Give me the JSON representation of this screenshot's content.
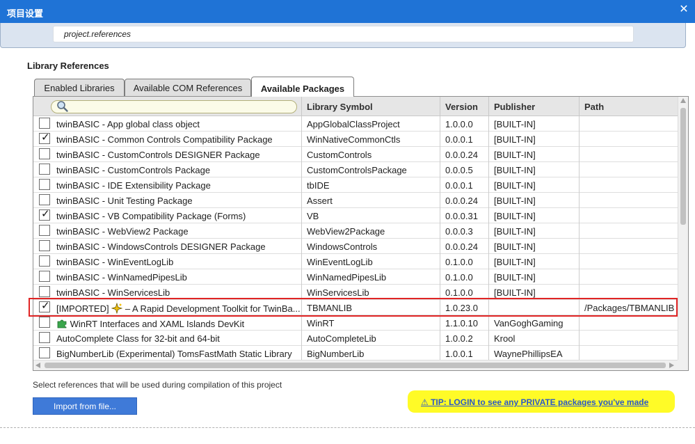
{
  "window": {
    "title": "项目设置",
    "close_glyph": "✕"
  },
  "search": {
    "value": "project.references"
  },
  "section": {
    "title": "Library References"
  },
  "tabs": [
    {
      "label": "Enabled Libraries",
      "active": false
    },
    {
      "label": "Available COM References",
      "active": false
    },
    {
      "label": "Available Packages",
      "active": true
    }
  ],
  "table": {
    "filter_icon": "magnifier-icon",
    "columns": [
      "",
      "Library Symbol",
      "Version",
      "Publisher",
      "Path"
    ],
    "rows": [
      {
        "checked": false,
        "name": "twinBASIC - App global class object",
        "symbol": "AppGlobalClassProject",
        "version": "1.0.0.0",
        "publisher": "[BUILT-IN]",
        "path": ""
      },
      {
        "checked": true,
        "name": "twinBASIC - Common Controls Compatibility Package",
        "symbol": "WinNativeCommonCtls",
        "version": "0.0.0.1",
        "publisher": "[BUILT-IN]",
        "path": ""
      },
      {
        "checked": false,
        "name": "twinBASIC - CustomControls DESIGNER Package",
        "symbol": "CustomControls",
        "version": "0.0.0.24",
        "publisher": "[BUILT-IN]",
        "path": ""
      },
      {
        "checked": false,
        "name": "twinBASIC - CustomControls Package",
        "symbol": "CustomControlsPackage",
        "version": "0.0.0.5",
        "publisher": "[BUILT-IN]",
        "path": ""
      },
      {
        "checked": false,
        "name": "twinBASIC - IDE Extensibility Package",
        "symbol": "tbIDE",
        "version": "0.0.0.1",
        "publisher": "[BUILT-IN]",
        "path": ""
      },
      {
        "checked": false,
        "name": "twinBASIC - Unit Testing Package",
        "symbol": "Assert",
        "version": "0.0.0.24",
        "publisher": "[BUILT-IN]",
        "path": ""
      },
      {
        "checked": true,
        "name": "twinBASIC - VB Compatibility Package (Forms)",
        "symbol": "VB",
        "version": "0.0.0.31",
        "publisher": "[BUILT-IN]",
        "path": ""
      },
      {
        "checked": false,
        "name": "twinBASIC - WebView2 Package",
        "symbol": "WebView2Package",
        "version": "0.0.0.3",
        "publisher": "[BUILT-IN]",
        "path": ""
      },
      {
        "checked": false,
        "name": "twinBASIC - WindowsControls DESIGNER Package",
        "symbol": "WindowsControls",
        "version": "0.0.0.24",
        "publisher": "[BUILT-IN]",
        "path": ""
      },
      {
        "checked": false,
        "name": "twinBASIC - WinEventLogLib",
        "symbol": "WinEventLogLib",
        "version": "0.1.0.0",
        "publisher": "[BUILT-IN]",
        "path": ""
      },
      {
        "checked": false,
        "name": "twinBASIC - WinNamedPipesLib",
        "symbol": "WinNamedPipesLib",
        "version": "0.1.0.0",
        "publisher": "[BUILT-IN]",
        "path": ""
      },
      {
        "checked": false,
        "name": "twinBASIC - WinServicesLib",
        "symbol": "WinServicesLib",
        "version": "0.1.0.0",
        "publisher": "[BUILT-IN]",
        "path": ""
      },
      {
        "checked": true,
        "name_prefix": "[IMPORTED]",
        "name_icon": "sparkle-icon",
        "name": "– A Rapid Development Toolkit for TwinBa...",
        "symbol": "TBMANLIB",
        "version": "1.0.23.0",
        "publisher": "",
        "path": "/Packages/TBMANLIB",
        "highlighted": true
      },
      {
        "checked": false,
        "name_icon": "puzzle-icon",
        "name": "WinRT Interfaces and XAML Islands DevKit",
        "symbol": "WinRT",
        "version": "1.1.0.10",
        "publisher": "VanGoghGaming",
        "path": ""
      },
      {
        "checked": false,
        "name": "AutoComplete Class for 32-bit and 64-bit",
        "symbol": "AutoCompleteLib",
        "version": "1.0.0.2",
        "publisher": "Krool",
        "path": ""
      },
      {
        "checked": false,
        "name": "BigNumberLib (Experimental) TomsFastMath Static Library",
        "symbol": "BigNumberLib",
        "version": "1.0.0.1",
        "publisher": "WaynePhillipsEA",
        "path": ""
      }
    ]
  },
  "footer": {
    "hint": "Select references that will be used during compilation of this project",
    "import_label": "Import from file...",
    "tip": "⚠ TIP: LOGIN to see any PRIVATE packages you've made"
  },
  "colors": {
    "titlebar": "#1f73d6",
    "import_button": "#3f7ad8",
    "tip_background": "#fffb27",
    "tip_text": "#2a58c7",
    "highlight_border": "#e02424"
  }
}
